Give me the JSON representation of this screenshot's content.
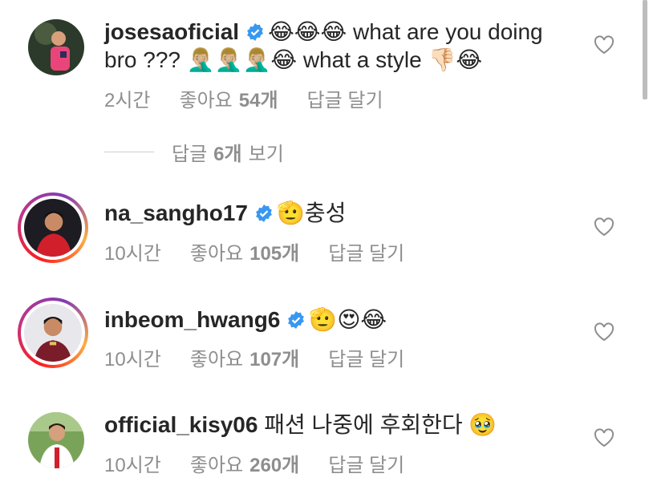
{
  "comments": [
    {
      "username": "josesaoficial",
      "verified": true,
      "text": "😂😂😂 what are you doing bro ??? 🤦🏼‍♂️🤦🏼‍♂️🤦🏼‍♂️😂 what a style 👎🏻😂",
      "time": "2시간",
      "likes_label": "좋아요",
      "likes_count": "54개",
      "reply_label": "답글 달기",
      "story_ring": false
    },
    {
      "username": "na_sangho17",
      "verified": true,
      "text": "🫡충성",
      "time": "10시간",
      "likes_label": "좋아요",
      "likes_count": "105개",
      "reply_label": "답글 달기",
      "story_ring": true
    },
    {
      "username": "inbeom_hwang6",
      "verified": true,
      "text": "🫡😍😂",
      "time": "10시간",
      "likes_label": "좋아요",
      "likes_count": "107개",
      "reply_label": "답글 달기",
      "story_ring": true
    },
    {
      "username": "official_kisy06",
      "verified": false,
      "text": "패션 나중에 후회한다 🥹",
      "time": "10시간",
      "likes_label": "좋아요",
      "likes_count": "260개",
      "reply_label": "답글 달기",
      "story_ring": false
    }
  ],
  "view_replies": {
    "prefix": "답글",
    "count": "6개",
    "suffix": "보기"
  },
  "colors": {
    "verified": "#3897f0",
    "meta": "#8e8e8e",
    "text": "#262626"
  }
}
